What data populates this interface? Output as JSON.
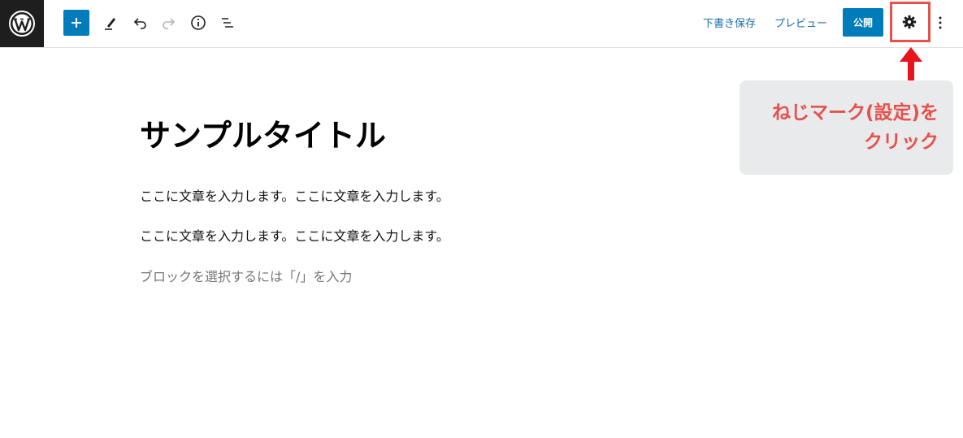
{
  "toolbar": {
    "save_draft_label": "下書き保存",
    "preview_label": "プレビュー",
    "publish_label": "公開"
  },
  "annotation": {
    "line1": "ねじマーク(設定)を",
    "line2": "クリック",
    "color": "#e8504b"
  },
  "editor": {
    "title": "サンプルタイトル",
    "paragraphs": [
      "ここに文章を入力します。ここに文章を入力します。",
      "ここに文章を入力します。ここに文章を入力します。"
    ],
    "block_placeholder": "ブロックを選択するには「/」を入力"
  },
  "colors": {
    "accent": "#007cba",
    "logo_bg": "#1e1e1e",
    "link": "#1a6fa6"
  },
  "icons": [
    "wordpress-logo-icon",
    "plus-icon",
    "pencil-icon",
    "undo-icon",
    "redo-icon",
    "info-icon",
    "list-view-icon",
    "gear-icon",
    "more-vertical-icon",
    "arrow-up-icon"
  ]
}
